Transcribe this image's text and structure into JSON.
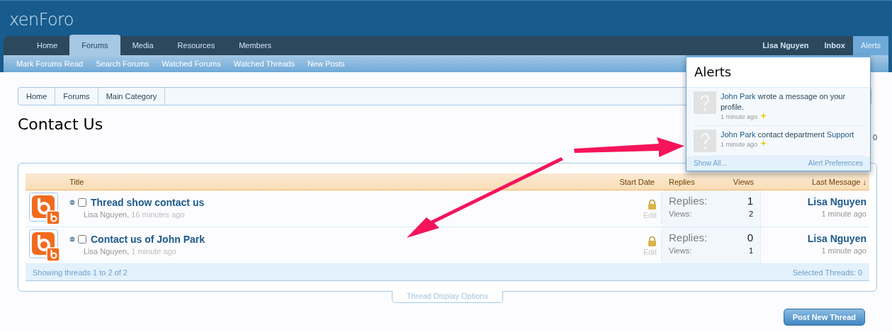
{
  "logo": "xenForo",
  "nav": {
    "tabs": [
      {
        "label": "Home",
        "selected": false
      },
      {
        "label": "Forums",
        "selected": true
      },
      {
        "label": "Media",
        "selected": false
      },
      {
        "label": "Resources",
        "selected": false
      },
      {
        "label": "Members",
        "selected": false
      }
    ],
    "account": [
      {
        "label": "Lisa Nguyen",
        "selected": false
      },
      {
        "label": "Inbox",
        "selected": false
      },
      {
        "label": "Alerts",
        "selected": true
      }
    ]
  },
  "subnav": [
    "Mark Forums Read",
    "Search Forums",
    "Watched Forums",
    "Watched Threads",
    "New Posts"
  ],
  "breadcrumb": [
    "Home",
    "Forums",
    "Main Category"
  ],
  "page_title": "Contact Us",
  "forum_tools_count": "0",
  "thread_list": {
    "columns": [
      "Title",
      "Start Date",
      "Replies",
      "Views",
      "Last Message ↓"
    ],
    "threads": [
      {
        "title": "Thread show contact us",
        "author": "Lisa Nguyen,",
        "time": "16 minutes ago",
        "checked": false,
        "locked": true,
        "edit": "Edit",
        "replies_label": "Replies:",
        "replies": "1",
        "views_label": "Views:",
        "views": "2",
        "last_user": "Lisa Nguyen",
        "last_time": "1 minute ago"
      },
      {
        "title": "Contact us of John Park",
        "author": "Lisa Nguyen,",
        "time": "1 minute ago",
        "checked": false,
        "locked": true,
        "edit": "Edit",
        "replies_label": "Replies:",
        "replies": "0",
        "views_label": "Views:",
        "views": "1",
        "last_user": "Lisa Nguyen",
        "last_time": "1 minute ago"
      }
    ],
    "footer": "Showing threads 1 to 2 of 2",
    "footer_right": "Selected Threads: 0"
  },
  "display_options": "Thread Display Options",
  "post_button": "Post New Thread",
  "alerts_popup": {
    "title": "Alerts",
    "items": [
      {
        "user": "John Park",
        "text": "wrote a message on your profile.",
        "time": "1 minute ago",
        "new": true
      },
      {
        "user": "John Park",
        "text": "contact department",
        "link": "Support",
        "time": "1 minute ago",
        "new": true
      }
    ],
    "show_all": "Show All...",
    "preferences": "Alert Preferences"
  }
}
